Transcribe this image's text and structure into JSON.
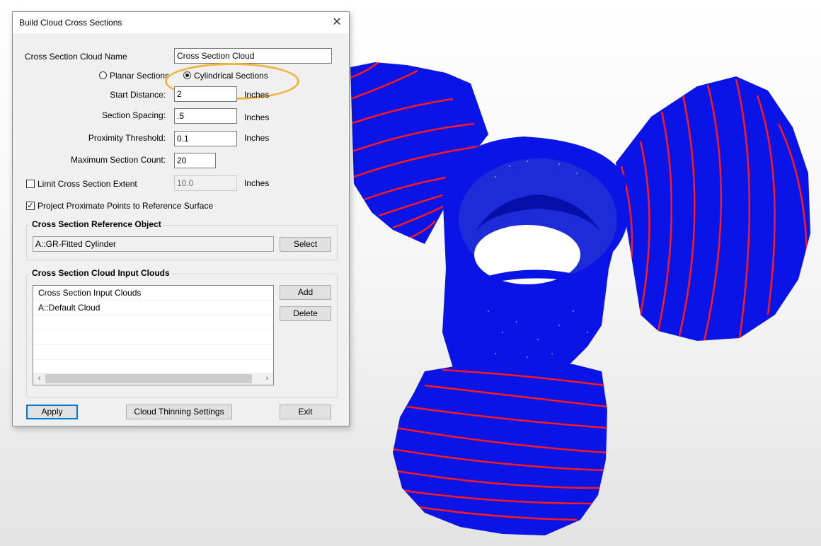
{
  "dialog": {
    "title": "Build Cloud Cross Sections",
    "close_glyph": "✕",
    "name_label": "Cross Section Cloud Name",
    "name_value": "Cross Section Cloud",
    "planar_label": "Planar Sections",
    "cylindrical_label": "Cylindrical Sections",
    "selected_mode": "cylindrical",
    "start_distance_label": "Start Distance:",
    "start_distance_value": "2",
    "start_distance_unit": "Inches",
    "spacing_label": "Section Spacing:",
    "spacing_value": ".5",
    "spacing_unit": "Inches",
    "proximity_label": "Proximity Threshold:",
    "proximity_value": "0.1",
    "proximity_unit": "Inches",
    "max_count_label": "Maximum Section Count:",
    "max_count_value": "20",
    "limit_extent_label": "Limit Cross Section Extent",
    "limit_extent_checked": false,
    "limit_extent_value": "10.0",
    "limit_extent_unit": "Inches",
    "project_label": "Project Proximate Points to Reference Surface",
    "project_checked": true,
    "check_glyph": "✓",
    "ref_group_title": "Cross Section Reference Object",
    "ref_value": "A::GR-Fitted Cylinder",
    "select_label": "Select",
    "clouds_group_title": "Cross Section Cloud Input Clouds",
    "clouds_header": "Cross Section Input Clouds",
    "clouds": [
      "A::Default Cloud"
    ],
    "add_label": "Add",
    "delete_label": "Delete",
    "scroll_left_glyph": "‹",
    "scroll_right_glyph": "›",
    "apply_label": "Apply",
    "thinning_label": "Cloud Thinning Settings",
    "exit_label": "Exit"
  },
  "colors": {
    "point_cloud": "#0a14e6",
    "section_line": "#ff1a1a",
    "highlight": "#f0b53f"
  }
}
